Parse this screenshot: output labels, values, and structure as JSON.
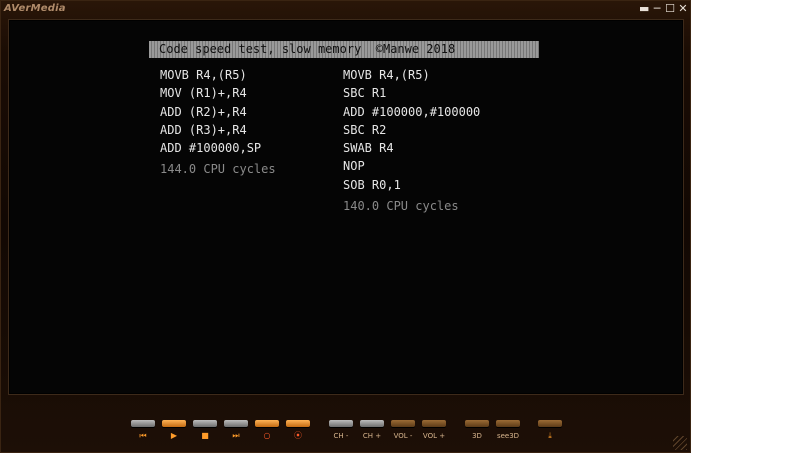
{
  "window": {
    "brand": "AVerMedia",
    "controls": {
      "minimize_glyph": "▬",
      "restore_glyph": "─",
      "maximize_glyph": "☐",
      "close_glyph": "✕"
    }
  },
  "screen": {
    "banner": "Code speed test, slow memory  ©Manwe 2018",
    "left_code": [
      "MOVB R4,(R5)",
      "MOV (R1)+,R4",
      "ADD (R2)+,R4",
      "ADD (R3)+,R4",
      "ADD #100000,SP"
    ],
    "left_cycles": "144.0 CPU cycles",
    "right_code": [
      "MOVB R4,(R5)",
      "SBC R1",
      "ADD #100000,#100000",
      "SBC R2",
      "SWAB R4",
      "NOP",
      "SOB R0,1"
    ],
    "right_cycles": "140.0 CPU cycles"
  },
  "controls": {
    "prev": {
      "icon": "prev-icon",
      "glyph": "⏮"
    },
    "play": {
      "icon": "play-icon",
      "glyph": "▶"
    },
    "stop": {
      "icon": "stop-icon",
      "glyph": "■"
    },
    "next": {
      "icon": "next-icon",
      "glyph": "⏭"
    },
    "record": {
      "icon": "record-icon",
      "glyph": "○"
    },
    "snapshot": {
      "icon": "snapshot-icon",
      "glyph": "⦿"
    },
    "ch_down": "CH -",
    "ch_up": "CH +",
    "vol_down": "VOL -",
    "vol_up": "VOL +",
    "three_d": "3D",
    "see3d": "see3D",
    "download": {
      "icon": "download-icon",
      "glyph": "⤓"
    }
  },
  "colors": {
    "accent": "#ff9c2a",
    "record": "#ff5a2a",
    "frame": "#1a0c04"
  }
}
